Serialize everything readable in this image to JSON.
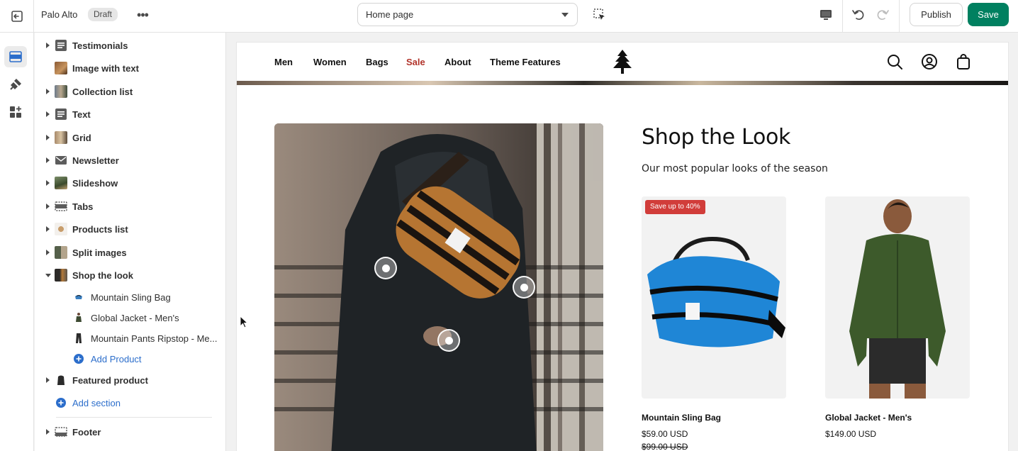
{
  "topbar": {
    "store_name": "Palo Alto",
    "status_badge": "Draft",
    "more_label": "•••",
    "page_select_value": "Home page",
    "publish_label": "Publish",
    "save_label": "Save"
  },
  "sidebar": {
    "sections": [
      {
        "label": "Testimonials",
        "icon": "text-block-icon"
      },
      {
        "label": "Image with text",
        "icon": "image-thumbnail"
      },
      {
        "label": "Collection list",
        "icon": "collection-thumbnail"
      },
      {
        "label": "Text",
        "icon": "text-block-icon"
      },
      {
        "label": "Grid",
        "icon": "grid-thumbnail"
      },
      {
        "label": "Newsletter",
        "icon": "envelope-icon"
      },
      {
        "label": "Slideshow",
        "icon": "slideshow-thumbnail"
      },
      {
        "label": "Tabs",
        "icon": "tabs-icon"
      },
      {
        "label": "Products list",
        "icon": "products-thumbnail"
      },
      {
        "label": "Split images",
        "icon": "split-thumbnail"
      },
      {
        "label": "Shop the look",
        "icon": "look-thumbnail"
      }
    ],
    "blocks": [
      {
        "label": "Mountain Sling Bag"
      },
      {
        "label": "Global Jacket - Men's"
      },
      {
        "label": "Mountain Pants Ripstop - Me..."
      }
    ],
    "add_product_label": "Add Product",
    "featured_product_label": "Featured product",
    "add_section_label": "Add section",
    "footer_label": "Footer"
  },
  "preview": {
    "nav": {
      "links": [
        "Men",
        "Women",
        "Bags",
        "Sale",
        "About",
        "Theme Features"
      ]
    },
    "shop_the_look": {
      "title": "Shop the Look",
      "subtitle": "Our most popular looks of the season",
      "products": [
        {
          "badge": "Save up to 40%",
          "title": "Mountain Sling Bag",
          "price": "$59.00 USD",
          "compare_price": "$99.00 USD"
        },
        {
          "title": "Global Jacket - Men's",
          "price": "$149.00 USD"
        }
      ]
    }
  },
  "colors": {
    "accent_green": "#008060",
    "sale_red": "#b2342b",
    "link_blue": "#2c6ecb",
    "badge_red": "#d13d3a"
  }
}
